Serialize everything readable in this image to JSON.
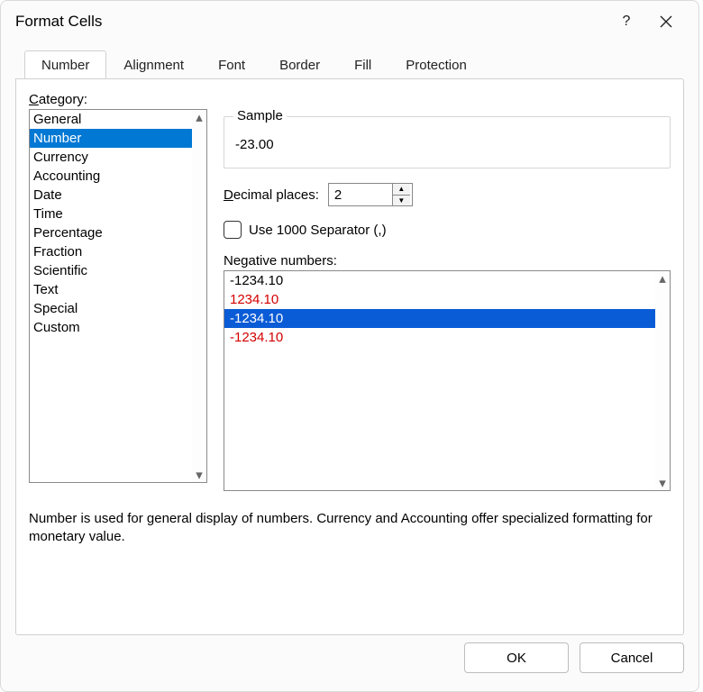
{
  "dialog": {
    "title": "Format Cells",
    "help_label": "?",
    "close_label": "✕"
  },
  "tabs": [
    "Number",
    "Alignment",
    "Font",
    "Border",
    "Fill",
    "Protection"
  ],
  "active_tab": "Number",
  "category_label_pre": "C",
  "category_label_post": "ategory:",
  "categories": [
    "General",
    "Number",
    "Currency",
    "Accounting",
    "Date",
    "Time",
    "Percentage",
    "Fraction",
    "Scientific",
    "Text",
    "Special",
    "Custom"
  ],
  "selected_category": "Number",
  "sample": {
    "legend": "Sample",
    "value": "-23.00"
  },
  "decimal": {
    "label_pre": "D",
    "label_post": "ecimal places:",
    "value": "2"
  },
  "separator": {
    "label_pre": "U",
    "label_post": "se 1000 Separator (,)",
    "checked": false
  },
  "negative": {
    "label_pre": "N",
    "label_post": "egative numbers:",
    "items": [
      {
        "text": "-1234.10",
        "color": "black"
      },
      {
        "text": "1234.10",
        "color": "red"
      },
      {
        "text": "-1234.10",
        "color": "black",
        "selected": true
      },
      {
        "text": "-1234.10",
        "color": "red"
      }
    ]
  },
  "description": "Number is used for general display of numbers.  Currency and Accounting offer specialized formatting for monetary value.",
  "buttons": {
    "ok": "OK",
    "cancel": "Cancel"
  }
}
